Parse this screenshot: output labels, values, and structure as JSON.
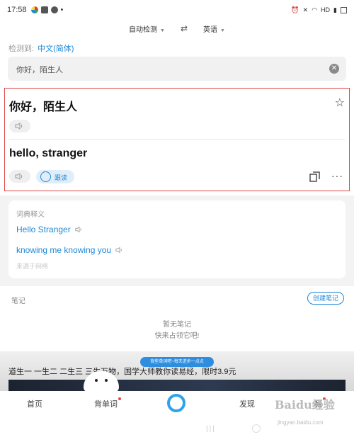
{
  "status_bar": {
    "time": "17:58",
    "network": "HD"
  },
  "language_bar": {
    "source": "自动检测",
    "target": "英语"
  },
  "detect": {
    "label": "检测到:",
    "language": "中文(简体)"
  },
  "input": {
    "value": "你好，陌生人"
  },
  "result": {
    "source_text": "你好，陌生人",
    "translation": "hello, stranger",
    "follow_read_label": "跟读"
  },
  "dictionary": {
    "title": "词典释义",
    "items": [
      "Hello Stranger",
      "knowing me knowing you"
    ],
    "source_note": "来源于网络"
  },
  "notes": {
    "title": "笔记",
    "create_button": "创建笔记",
    "empty_line1": "暂无笔记",
    "empty_line2": "快来占领它吧!"
  },
  "banner": {
    "bubble": "背些单词吧~每天进步一点点",
    "text": "道生一 一生二 二生三 三生万物，国学大师教你读易经，限时3.9元"
  },
  "tabs": [
    {
      "label": "首页"
    },
    {
      "label": "背单词"
    },
    {
      "label": "发现"
    },
    {
      "label": "我"
    }
  ],
  "watermark": {
    "logo": "Baidu经验",
    "url": "jingyan.baidu.com"
  },
  "colors": {
    "accent": "#1e88d6",
    "highlight": "#e04848"
  }
}
